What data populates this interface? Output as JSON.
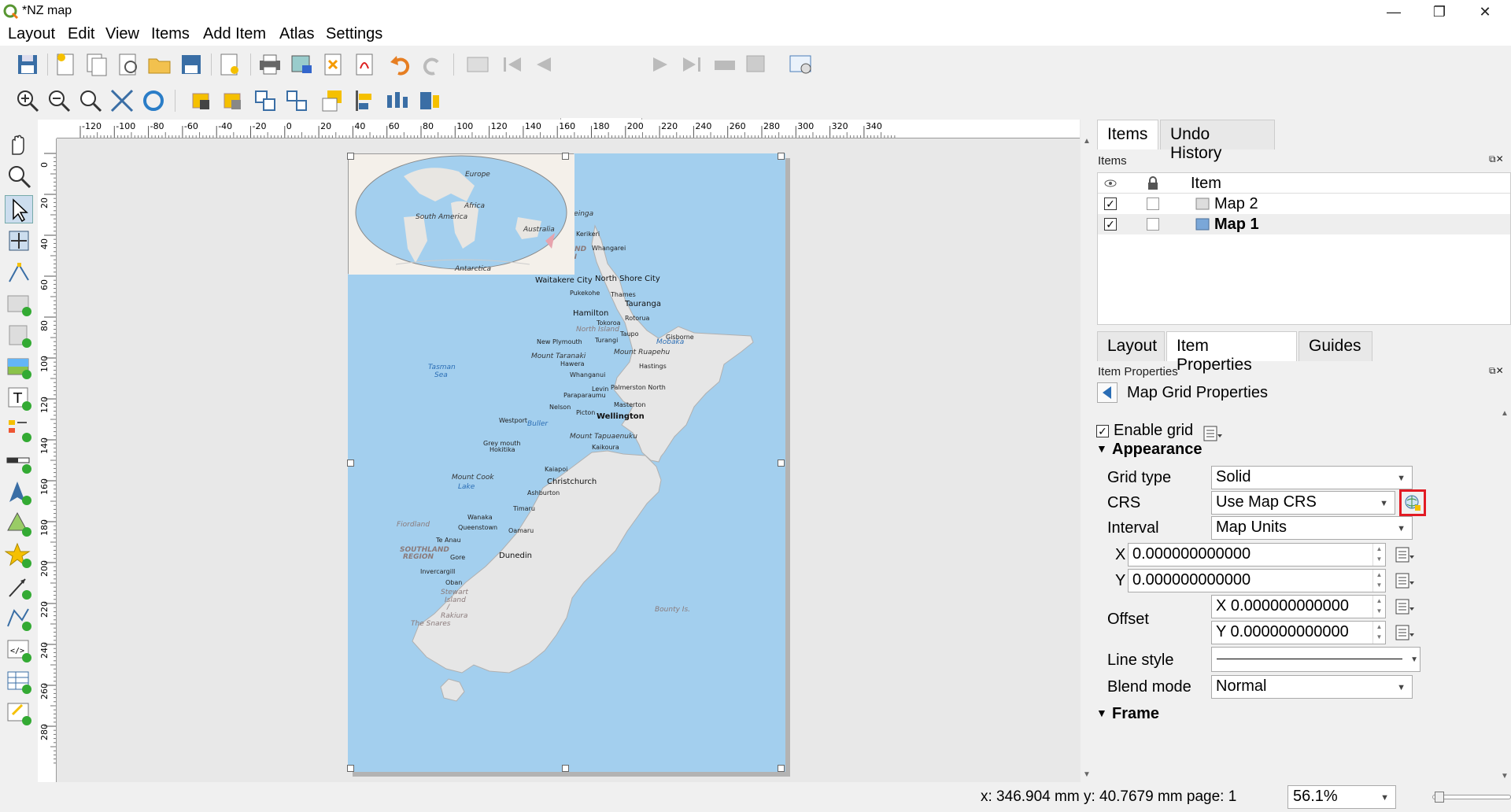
{
  "window": {
    "title": "*NZ map"
  },
  "menu": [
    "Layout",
    "Edit",
    "View",
    "Items",
    "Add Item",
    "Atlas",
    "Settings"
  ],
  "atlas_toolbar": {
    "page_value": "1"
  },
  "rulers": {
    "h_ticks": [
      "-120",
      "-100",
      "-80",
      "-60",
      "-40",
      "-20",
      "0",
      "20",
      "40",
      "60",
      "80",
      "100",
      "120",
      "140",
      "160",
      "180",
      "200",
      "220",
      "240",
      "260",
      "280",
      "300",
      "320",
      "340"
    ],
    "v_ticks": [
      "0",
      "20",
      "40",
      "60",
      "80",
      "100",
      "120",
      "140",
      "160",
      "180",
      "200",
      "220",
      "240",
      "260",
      "280"
    ]
  },
  "map": {
    "inset_labels": [
      "Europe",
      "Africa",
      "South America",
      "Australia",
      "Antarctica"
    ],
    "labels": [
      {
        "t": "Cape Reinga"
      },
      {
        "t": "Kerikeri"
      },
      {
        "t": "Whangarei"
      },
      {
        "t": "NORTHLAND"
      },
      {
        "t": "REGION"
      },
      {
        "t": "Waitakere City"
      },
      {
        "t": "North Shore City"
      },
      {
        "t": "Pukekohe"
      },
      {
        "t": "Thames"
      },
      {
        "t": "Hamilton"
      },
      {
        "t": "Tauranga"
      },
      {
        "t": "Tokoroa"
      },
      {
        "t": "Rotorua"
      },
      {
        "t": "North Island"
      },
      {
        "t": "Taupo"
      },
      {
        "t": "Gisborne"
      },
      {
        "t": "New Plymouth"
      },
      {
        "t": "Turangi"
      },
      {
        "t": "Mount Taranaki"
      },
      {
        "t": "Mount Ruapehu"
      },
      {
        "t": "Hawera"
      },
      {
        "t": "Hastings"
      },
      {
        "t": "Whanganui"
      },
      {
        "t": "Tasman"
      },
      {
        "t": "Sea"
      },
      {
        "t": "Levin"
      },
      {
        "t": "Palmerston North"
      },
      {
        "t": "Paraparaumu"
      },
      {
        "t": "Masterton"
      },
      {
        "t": "Nelson"
      },
      {
        "t": "Picton"
      },
      {
        "t": "Wellington"
      },
      {
        "t": "Westport"
      },
      {
        "t": "Mount Tapuaenuku"
      },
      {
        "t": "Grey mouth"
      },
      {
        "t": "Hokitika"
      },
      {
        "t": "Kaikoura"
      },
      {
        "t": "Kaiapoi"
      },
      {
        "t": "Mount Cook"
      },
      {
        "t": "Christchurch"
      },
      {
        "t": "Ashburton"
      },
      {
        "t": "Timaru"
      },
      {
        "t": "Fiordland"
      },
      {
        "t": "Wanaka"
      },
      {
        "t": "Queenstown"
      },
      {
        "t": "Oamaru"
      },
      {
        "t": "Te Anau"
      },
      {
        "t": "SOUTHLAND"
      },
      {
        "t": "REGION"
      },
      {
        "t": "Dunedin"
      },
      {
        "t": "Gore"
      },
      {
        "t": "Invercargill"
      },
      {
        "t": "Oban"
      },
      {
        "t": "Stewart"
      },
      {
        "t": "Island"
      },
      {
        "t": "/"
      },
      {
        "t": "Rakiura"
      },
      {
        "t": "The Snares"
      },
      {
        "t": "Bounty Is."
      },
      {
        "t": "Mobaka"
      },
      {
        "t": "Lake"
      },
      {
        "t": "Buller"
      }
    ]
  },
  "dock": {
    "top_tabs": [
      "Items",
      "Undo History"
    ],
    "items_label": "Items",
    "items_header": "Item",
    "items": [
      {
        "name": "Map 2",
        "visible": "✓",
        "bold": false
      },
      {
        "name": "Map 1",
        "visible": "✓",
        "bold": true
      }
    ],
    "bottom_tabs": [
      "Layout",
      "Item Properties",
      "Guides"
    ],
    "item_props_label": "Item Properties",
    "back_title": "Map Grid Properties",
    "enable_grid": {
      "label": "Enable grid",
      "checked": "✓"
    },
    "appearance_label": "Appearance",
    "grid_type": {
      "label": "Grid type",
      "value": "Solid"
    },
    "crs": {
      "label": "CRS",
      "value": "Use Map CRS"
    },
    "interval": {
      "label": "Interval",
      "value": "Map Units"
    },
    "x": {
      "label": "X",
      "value": "0.000000000000"
    },
    "y": {
      "label": "Y",
      "value": "0.000000000000"
    },
    "offset": {
      "label": "Offset",
      "x": "X 0.000000000000",
      "y": "Y 0.000000000000"
    },
    "line_style": {
      "label": "Line style"
    },
    "blend_mode": {
      "label": "Blend mode",
      "value": "Normal"
    },
    "frame_label": "Frame"
  },
  "status": {
    "coords": "x: 346.904 mm y: 40.7679 mm page: 1",
    "zoom": "56.1%"
  },
  "colors": {
    "sea": "#a3cfee",
    "land": "#e9e9e9",
    "highlight": "#e21b24"
  }
}
